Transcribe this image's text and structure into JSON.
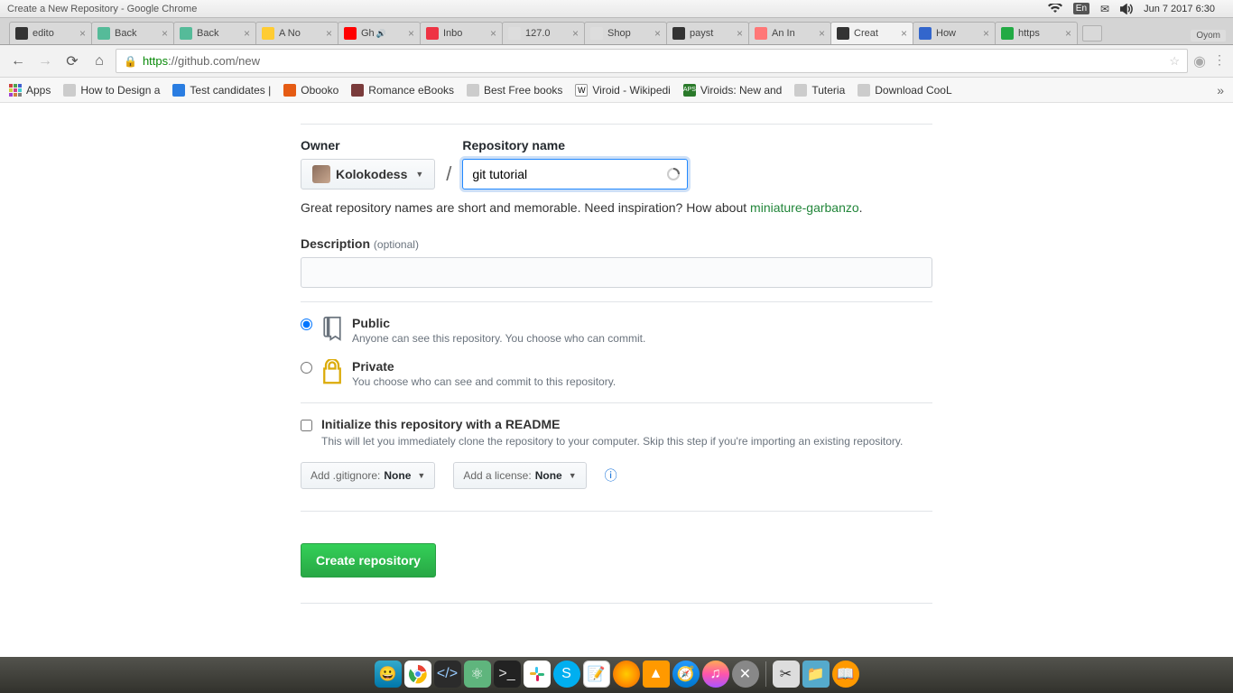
{
  "menubar": {
    "window_title": "Create a New Repository - Google Chrome",
    "lang": "En",
    "date": "Jun 7 2017  6:30"
  },
  "tabs": [
    {
      "label": "edito"
    },
    {
      "label": "Back"
    },
    {
      "label": "Back"
    },
    {
      "label": "A No"
    },
    {
      "label": "Gh"
    },
    {
      "label": "Inbo"
    },
    {
      "label": "127.0"
    },
    {
      "label": "Shop"
    },
    {
      "label": "payst"
    },
    {
      "label": "An In"
    },
    {
      "label": "Creat",
      "active": true
    },
    {
      "label": "How"
    },
    {
      "label": "https"
    }
  ],
  "tabs_user": "Oyom",
  "address": {
    "scheme": "https",
    "rest": "://github.com/new"
  },
  "bookmarks": {
    "apps": "Apps",
    "items": [
      "How to Design a",
      "Test candidates |",
      "Obooko",
      "Romance eBooks",
      "Best Free books",
      "Viroid - Wikipedi",
      "Viroids: New and",
      "Tuteria",
      "Download CooL"
    ]
  },
  "form": {
    "owner_label": "Owner",
    "owner_value": "Kolokodess",
    "repo_label": "Repository name",
    "repo_value": "git tutorial",
    "hint_pre": "Great repository names are short and memorable. Need inspiration? How about ",
    "hint_suggest": "miniature-garbanzo",
    "hint_post": ".",
    "desc_label": "Description",
    "optional": "(optional)",
    "public_title": "Public",
    "public_desc": "Anyone can see this repository. You choose who can commit.",
    "private_title": "Private",
    "private_desc": "You choose who can see and commit to this repository.",
    "init_title": "Initialize this repository with a README",
    "init_desc": "This will let you immediately clone the repository to your computer. Skip this step if you're importing an existing repository.",
    "gitignore_prefix": "Add .gitignore: ",
    "gitignore_value": "None",
    "license_prefix": "Add a license: ",
    "license_value": "None",
    "submit": "Create repository"
  }
}
